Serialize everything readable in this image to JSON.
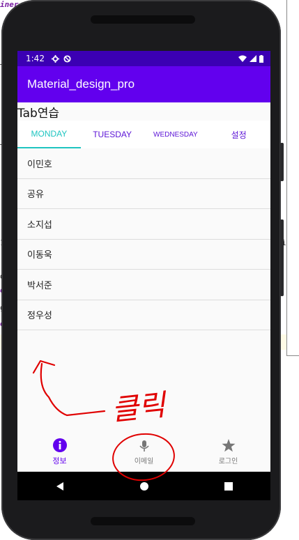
{
  "background_editor": {
    "frag1": "iner",
    "frag2": "T",
    "frag3": "T",
    "frag4": "1",
    "frag5": "d",
    "frag6": "o",
    "frag7": "g",
    "frag8": "o",
    "frag9": "i"
  },
  "status_bar": {
    "time": "1:42"
  },
  "app_bar": {
    "title": "Material_design_pro"
  },
  "page": {
    "heading": "Tab연습"
  },
  "tabs": [
    {
      "label": "MONDAY",
      "active": true
    },
    {
      "label": "TUESDAY",
      "active": false
    },
    {
      "label": "WEDNESDAY",
      "active": false
    },
    {
      "label": "설정",
      "active": false
    }
  ],
  "list_items": [
    "이민호",
    "공유",
    "소지섭",
    "이동욱",
    "박서준",
    "정우성"
  ],
  "bottom_nav": [
    {
      "label": "정보",
      "icon": "info-icon",
      "active": true
    },
    {
      "label": "이메일",
      "icon": "mic-icon",
      "active": false
    },
    {
      "label": "로그인",
      "icon": "star-icon",
      "active": false
    }
  ],
  "annotation": {
    "text": "클릭",
    "color": "#e00000"
  },
  "colors": {
    "primary": "#6200ee",
    "status_bar": "#3b00b3",
    "tab_active": "#1fc5c1"
  }
}
